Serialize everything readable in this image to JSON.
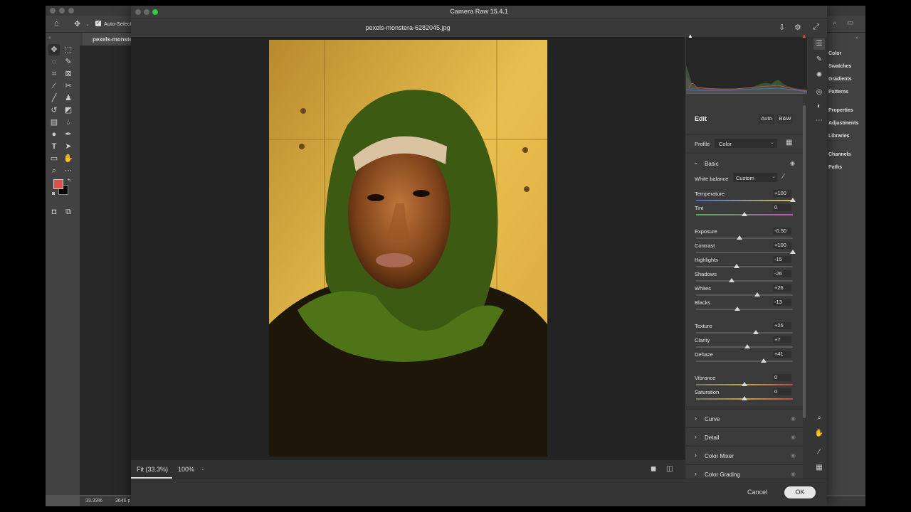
{
  "photoshop": {
    "options": {
      "auto_select_label": "Auto-Select"
    },
    "doc_tab": "pexels-monste",
    "panels": [
      "Color",
      "Swatches",
      "Gradients",
      "Patterns",
      "Properties",
      "Adjustments",
      "Libraries",
      "Channels",
      "Paths"
    ],
    "status": {
      "zoom": "33.33%",
      "info": "3646 p"
    },
    "colors": {
      "foreground": "#d9534a",
      "background": "#000000"
    }
  },
  "camera_raw": {
    "title": "Camera Raw 15.4.1",
    "filename": "pexels-monstera-6282045.jpg",
    "zoom": {
      "fit_label": "Fit (33.3%)",
      "percent_label": "100%"
    },
    "buttons": {
      "cancel": "Cancel",
      "ok": "OK"
    },
    "edit": {
      "title": "Edit",
      "auto_label": "Auto",
      "bw_label": "B&W",
      "profile_label": "Profile",
      "profile_value": "Color"
    },
    "basic": {
      "title": "Basic",
      "white_balance_label": "White balance",
      "white_balance_value": "Custom",
      "sliders": [
        {
          "label": "Temperature",
          "value": "+100",
          "pos": 1.0,
          "group": 0
        },
        {
          "label": "Tint",
          "value": "0",
          "pos": 0.5,
          "group": 0
        },
        {
          "label": "Exposure",
          "value": "-0.50",
          "pos": 0.45,
          "group": 1
        },
        {
          "label": "Contrast",
          "value": "+100",
          "pos": 1.0,
          "group": 1
        },
        {
          "label": "Highlights",
          "value": "-15",
          "pos": 0.42,
          "group": 1
        },
        {
          "label": "Shadows",
          "value": "-26",
          "pos": 0.37,
          "group": 1
        },
        {
          "label": "Whites",
          "value": "+26",
          "pos": 0.63,
          "group": 1
        },
        {
          "label": "Blacks",
          "value": "-13",
          "pos": 0.43,
          "group": 1
        },
        {
          "label": "Texture",
          "value": "+25",
          "pos": 0.62,
          "group": 2
        },
        {
          "label": "Clarity",
          "value": "+7",
          "pos": 0.53,
          "group": 2
        },
        {
          "label": "Dehaze",
          "value": "+41",
          "pos": 0.7,
          "group": 2
        },
        {
          "label": "Vibrance",
          "value": "0",
          "pos": 0.5,
          "group": 3
        },
        {
          "label": "Saturation",
          "value": "0",
          "pos": 0.5,
          "group": 3
        }
      ]
    },
    "sections": [
      "Curve",
      "Detail",
      "Color Mixer",
      "Color Grading"
    ]
  }
}
